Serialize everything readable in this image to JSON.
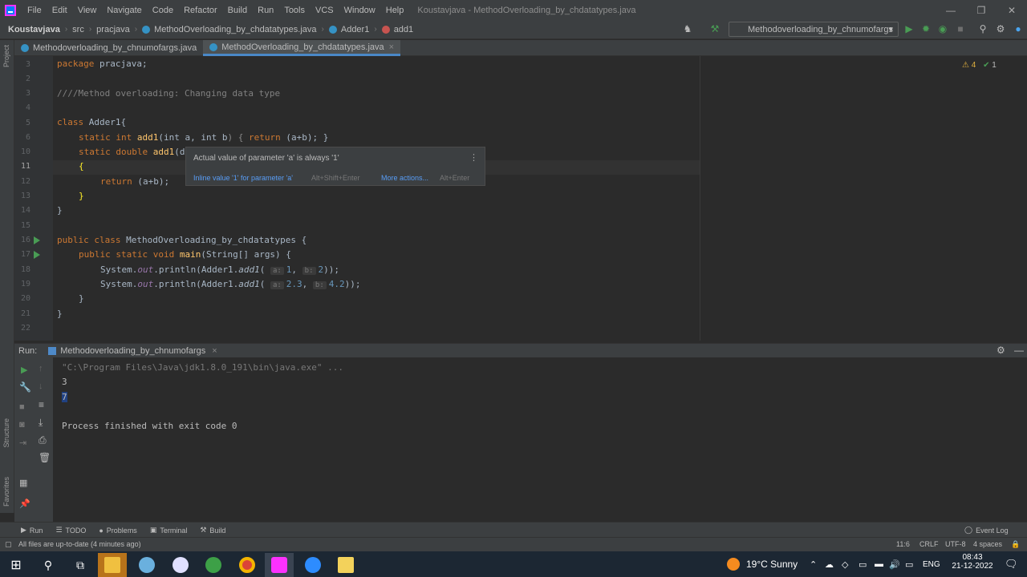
{
  "menubar": {
    "items": [
      "File",
      "Edit",
      "View",
      "Navigate",
      "Code",
      "Refactor",
      "Build",
      "Run",
      "Tools",
      "VCS",
      "Window",
      "Help"
    ],
    "title": "Koustavjava - MethodOverloading_by_chdatatypes.java"
  },
  "navbar": {
    "crumbs": [
      "Koustavjava",
      "src",
      "pracjava",
      "MethodOverloading_by_chdatatypes.java",
      "Adder1",
      "add1"
    ],
    "run_config": "Methodoverloading_by_chnumofargs"
  },
  "tabs": [
    "Methodoverloading_by_chnumofargs.java",
    "MethodOverloading_by_chdatatypes.java"
  ],
  "sidebar": {
    "project": "Project",
    "structure": "Structure",
    "favorites": "Favorites"
  },
  "editor": {
    "line_numbers": [
      "3",
      "",
      "4",
      "",
      "5",
      "6",
      "10",
      "11",
      "12",
      "13",
      "14",
      "",
      "16",
      "17",
      "18",
      "19",
      "20",
      "21",
      "22"
    ],
    "line_nums": [
      "3",
      "2",
      "3",
      "4",
      "5",
      "6",
      "10",
      "11",
      "12",
      "13",
      "14",
      "15",
      "16",
      "17",
      "18",
      "19",
      "20",
      "21",
      "22"
    ],
    "inspections": {
      "warnings": "4",
      "weak_warnings": "1"
    },
    "lines": {
      "l1_kw": "package",
      "l1_rest": " pracjava;",
      "l3": "////Method overloading: Changing data type",
      "l5_kw": "class",
      "l5_rest": " Adder1{",
      "l6_a": "static int ",
      "l6_fn": "add1",
      "l6_b": "(int ",
      "l6_c": "a, int b",
      "l6_d": ") { ",
      "l6_ret": "return",
      "l6_e": " (a+b); }",
      "l10_a": "static double ",
      "l10_fn": "add1",
      "l10_b": "(d",
      "l11": "{",
      "l12_ret": "return",
      "l12_rest": " (a+b);",
      "l13": "}",
      "l14": "}",
      "l16_a": "public class ",
      "l16_rest": "MethodOverloading_by_chdatatypes {",
      "l17_a": "public static void ",
      "l17_fn": "main",
      "l17_rest": "(String[] args) {",
      "l18_a": "System.",
      "l18_out": "out",
      "l18_b": ".println(Adder1.",
      "l18_fn": "add1",
      "l18_c": "( ",
      "l18_h1": "a:",
      "l18_v1": "1",
      "l18_comma": ", ",
      "l18_h2": "b:",
      "l18_v2": "2",
      "l18_end": "));",
      "l19_a": "System.",
      "l19_out": "out",
      "l19_b": ".println(Adder1.",
      "l19_fn": "add1",
      "l19_c": "( ",
      "l19_h1": "a:",
      "l19_v1": "2.3",
      "l19_comma": ", ",
      "l19_h2": "b:",
      "l19_v2": "4.2",
      "l19_end": "));",
      "l20": "}",
      "l21": "}"
    }
  },
  "popup": {
    "message": "Actual value of parameter 'a' is always '1'",
    "action1": "Inline value '1' for parameter 'a'",
    "action1_shortcut": "Alt+Shift+Enter",
    "action2": "More actions...",
    "action2_shortcut": "Alt+Enter"
  },
  "run_panel": {
    "label": "Run:",
    "tab": "Methodoverloading_by_chnumofargs",
    "console": [
      "\"C:\\Program Files\\Java\\jdk1.8.0_191\\bin\\java.exe\" ...",
      "3",
      "7",
      "",
      "Process finished with exit code 0"
    ]
  },
  "toolstrip": [
    "Run",
    "TODO",
    "Problems",
    "Terminal",
    "Build",
    "Event Log"
  ],
  "statusbar": {
    "message": "All files are up-to-date (4 minutes ago)",
    "position": "11:6",
    "line_sep": "CRLF",
    "encoding": "UTF-8",
    "indent": "4 spaces"
  },
  "taskbar": {
    "weather": "19°C  Sunny",
    "lang": "ENG",
    "time": "08:43",
    "date": "21-12-2022"
  }
}
